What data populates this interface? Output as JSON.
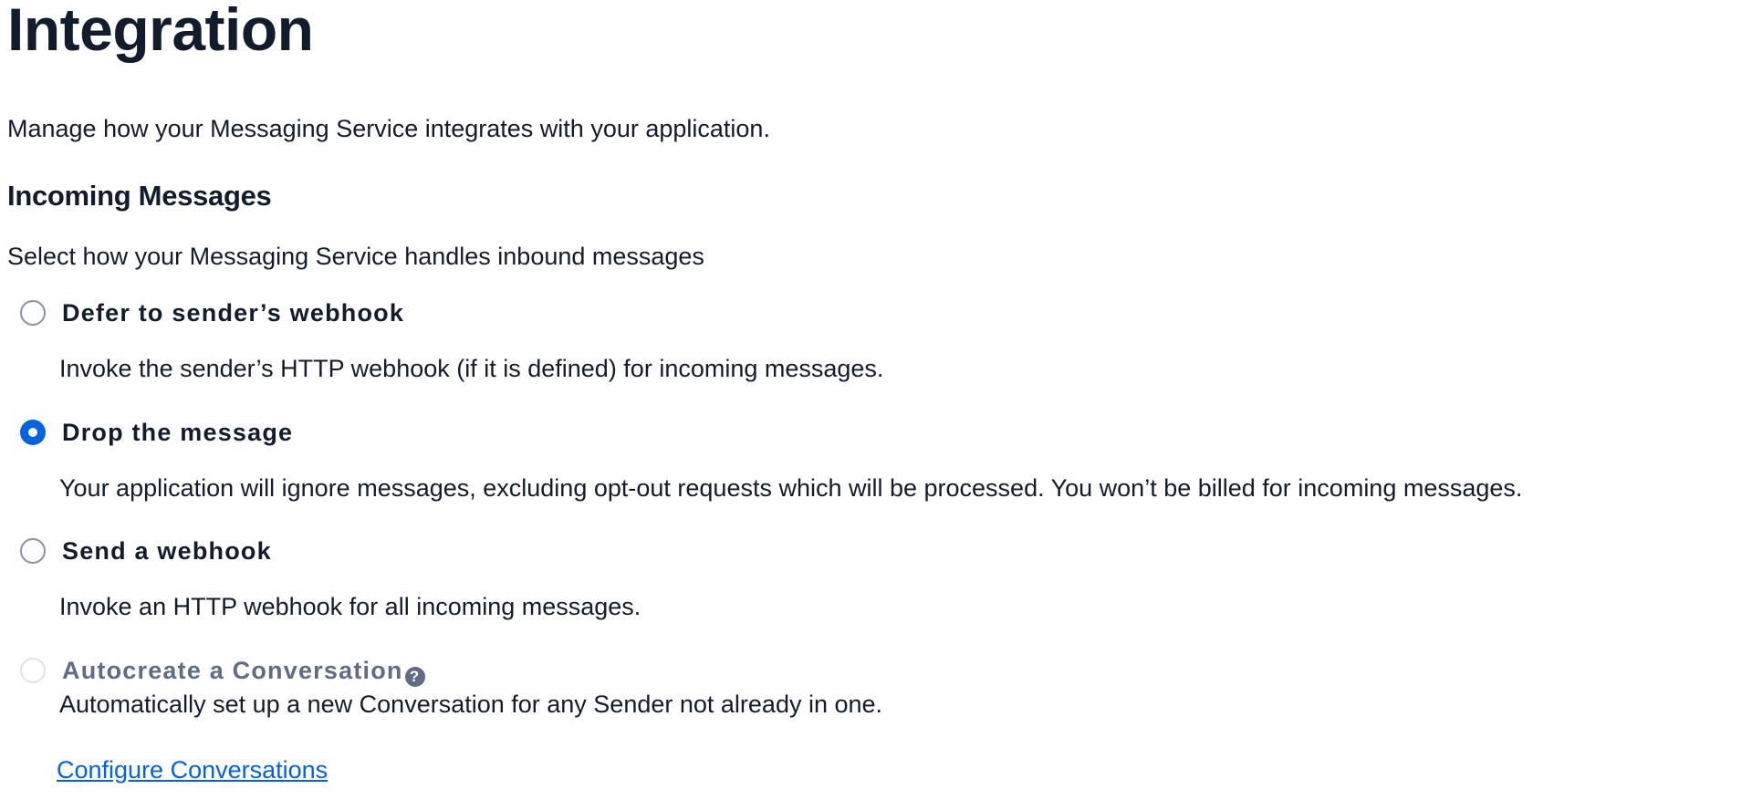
{
  "page": {
    "title": "Integration",
    "description": "Manage how your Messaging Service integrates with your application."
  },
  "incoming": {
    "title": "Incoming Messages",
    "description": "Select how your Messaging Service handles inbound messages",
    "options": [
      {
        "label": "Defer to sender’s webhook",
        "description": "Invoke the sender’s HTTP webhook (if it is defined) for incoming messages.",
        "selected": false,
        "disabled": false
      },
      {
        "label": "Drop the message",
        "description": "Your application will ignore messages, excluding opt-out requests which will be processed. You won’t be billed for incoming messages.",
        "selected": true,
        "disabled": false
      },
      {
        "label": "Send a webhook",
        "description": "Invoke an HTTP webhook for all incoming messages.",
        "selected": false,
        "disabled": false
      },
      {
        "label": "Autocreate a Conversation",
        "description": "Automatically set up a new Conversation for any Sender not already in one.",
        "selected": false,
        "disabled": true,
        "help_icon": "question-circle-icon",
        "help_glyph": "?"
      }
    ],
    "configure_link": "Configure Conversations"
  },
  "colors": {
    "text": "#121c2d",
    "accent": "#0263e0",
    "muted": "#606b85",
    "radio_border": "#8891aa"
  }
}
